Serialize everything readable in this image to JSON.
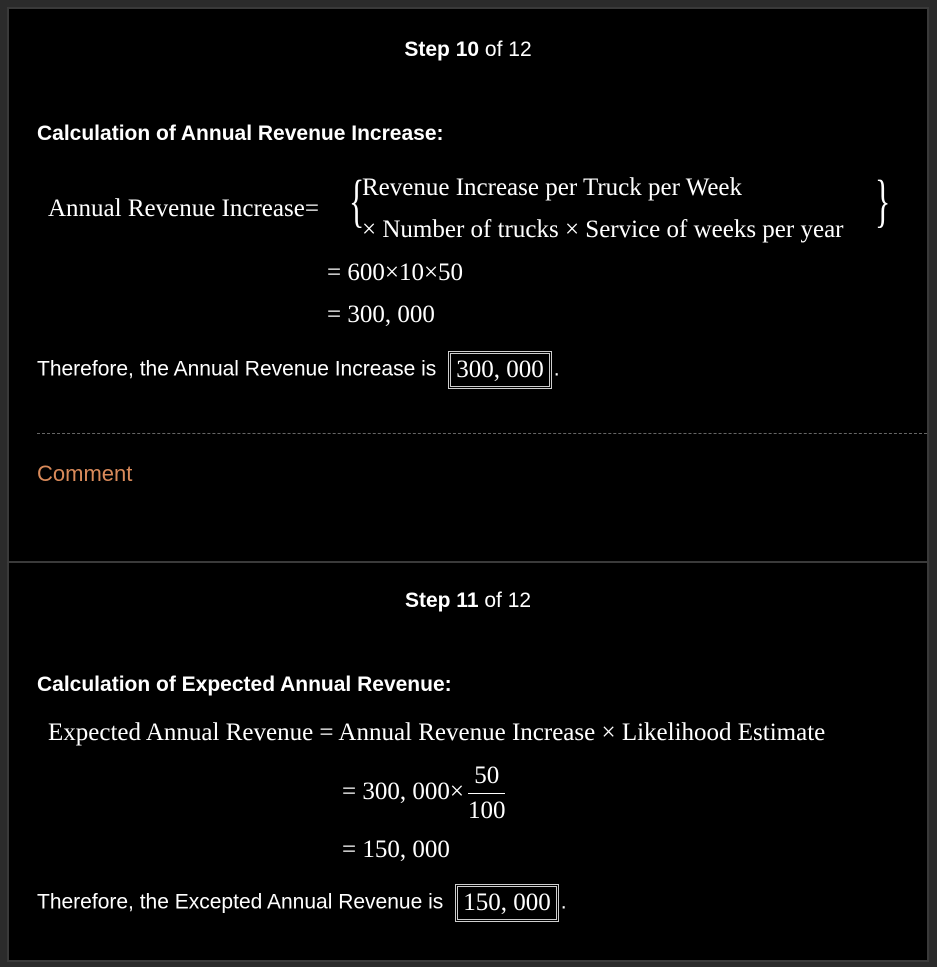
{
  "step10": {
    "header_prefix": "Step",
    "header_num": "10",
    "header_suffix": "of 12",
    "heading": "Calculation of Annual Revenue Increase:",
    "eq_lhs": "Annual Revenue Increase",
    "eq_equals": "=",
    "eq_line1": "Revenue Increase per Truck per Week",
    "eq_line2": "× Number of trucks × Service of weeks per year",
    "eq_step2": "= 600×10×50",
    "eq_step3": "= 300, 000",
    "conclusion": "Therefore, the Annual Revenue Increase is",
    "answer": "300, 000",
    "period": ".",
    "comment": "Comment"
  },
  "step11": {
    "header_prefix": "Step",
    "header_num": "11",
    "header_suffix": "of 12",
    "heading": "Calculation of Expected Annual Revenue:",
    "eq_line1": "Expected Annual Revenue = Annual Revenue Increase × Likelihood Estimate",
    "eq_step2_prefix": "= 300, 000×",
    "frac_num": "50",
    "frac_den": "100",
    "eq_step3": "= 150, 000",
    "conclusion": "Therefore, the Excepted Annual Revenue is",
    "answer": "150, 000",
    "period": "."
  },
  "colors": {
    "background": "#000000",
    "frame_border": "#3a3a3a",
    "comment_link": "#d98a5a",
    "text": "#ffffff"
  }
}
